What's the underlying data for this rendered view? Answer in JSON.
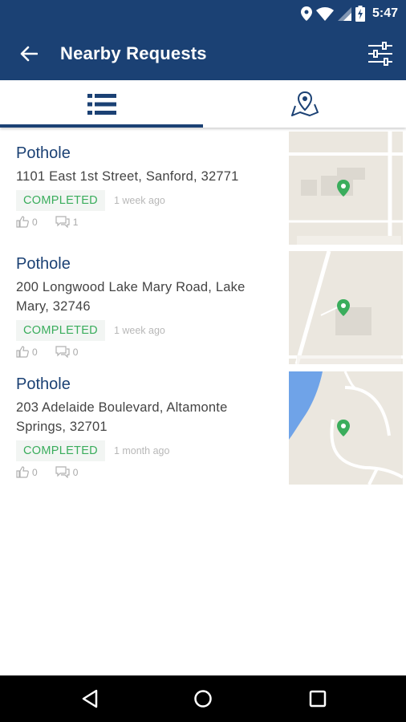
{
  "status_bar": {
    "time": "5:47",
    "icons": [
      "location-icon",
      "wifi-icon",
      "signal-icon",
      "battery-charging-icon"
    ]
  },
  "toolbar": {
    "title": "Nearby Requests",
    "back_icon": "arrow-back-icon",
    "filter_icon": "sliders-icon"
  },
  "tabs": [
    {
      "name": "list",
      "icon": "list-icon",
      "selected": true
    },
    {
      "name": "map",
      "icon": "map-pin-icon",
      "selected": false
    }
  ],
  "requests": [
    {
      "title": "Pothole",
      "address": "1101  East 1st Street, Sanford, 32771",
      "status": "COMPLETED",
      "time_ago": "1 week ago",
      "votes": "0",
      "comments": "1"
    },
    {
      "title": "Pothole",
      "address": "200  Longwood Lake Mary Road, Lake Mary, 32746",
      "status": "COMPLETED",
      "time_ago": "1 week ago",
      "votes": "0",
      "comments": "0"
    },
    {
      "title": "Pothole",
      "address": "203  Adelaide Boulevard, Altamonte Springs, 32701",
      "status": "COMPLETED",
      "time_ago": "1 month ago",
      "votes": "0",
      "comments": "0"
    }
  ],
  "colors": {
    "primary": "#1b4174",
    "status_completed": "#3aad5c",
    "map_pin": "#3aad5c"
  },
  "nav_bar": {
    "buttons": [
      "back-triangle-icon",
      "home-circle-icon",
      "recents-square-icon"
    ]
  }
}
